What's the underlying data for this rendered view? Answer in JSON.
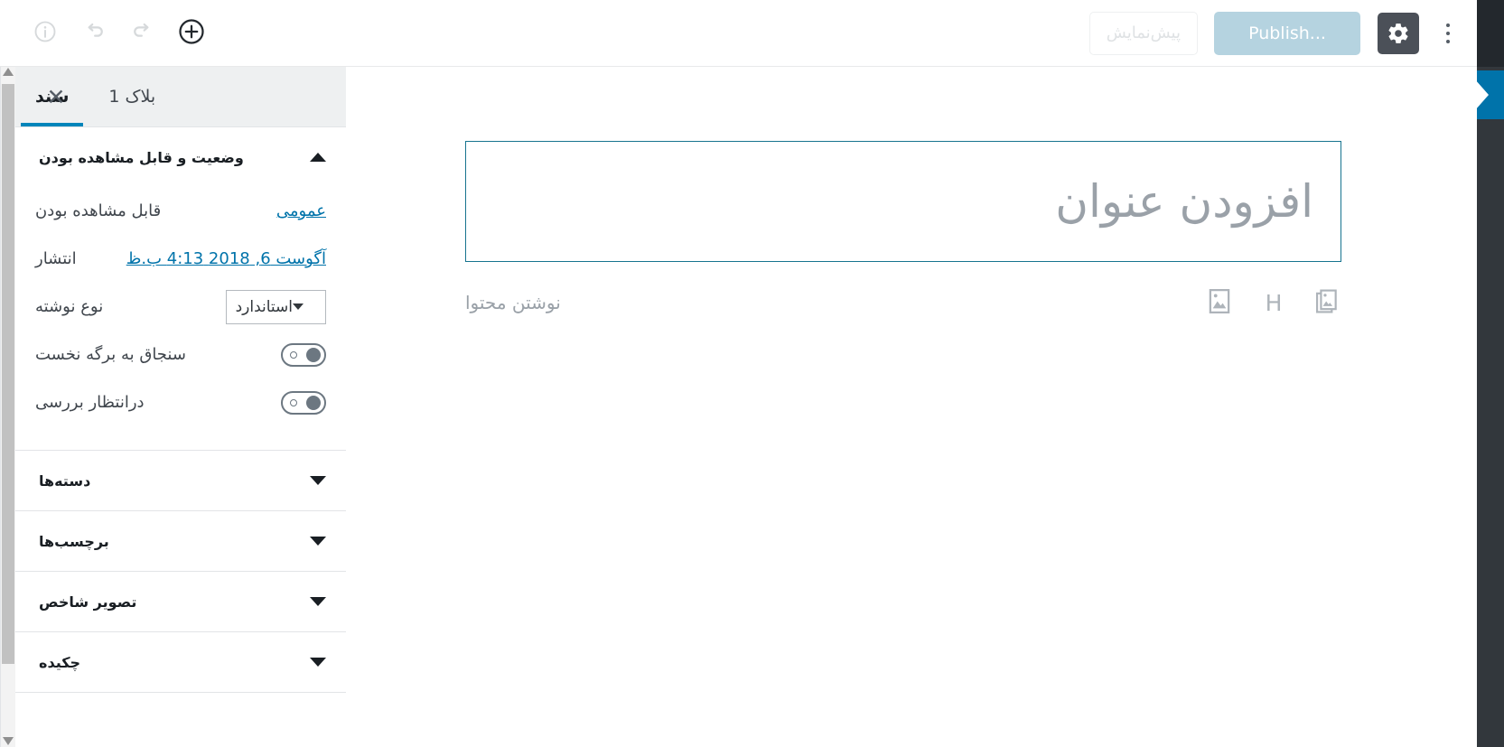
{
  "topbar": {
    "ellipsis_label": "گزینه‌های بیشتر",
    "gear_icon": "gear-icon",
    "publish_label": "Publish...",
    "preview_label": "پیش‌نمایش",
    "info_icon": "info-icon",
    "redo_icon": "redo-icon",
    "undo_icon": "undo-icon",
    "add_block_icon": "plus-circle-icon"
  },
  "sidebar": {
    "tabs": [
      {
        "label": "سند",
        "active": true
      },
      {
        "label": "بلاک 1",
        "active": false
      }
    ],
    "close_label": "✕",
    "panels": [
      {
        "title": "وضعیت و قابل مشاهده بودن",
        "expanded": true,
        "rows": [
          {
            "label": "قابل مشاهده بودن",
            "value": "عمومی",
            "type": "link"
          },
          {
            "label": "انتشار",
            "value": "آگوست 6, 2018 4:13 ب.ظ",
            "type": "link"
          },
          {
            "label": "نوع نوشته",
            "value": "استاندارد",
            "type": "select"
          },
          {
            "label": "سنجاق به برگه نخست",
            "value": "off",
            "type": "toggle"
          },
          {
            "label": "درانتظار بررسی",
            "value": "off",
            "type": "toggle"
          }
        ]
      },
      {
        "title": "دسته‌ها",
        "expanded": false,
        "rows": []
      },
      {
        "title": "برچسب‌ها",
        "expanded": false,
        "rows": []
      },
      {
        "title": "تصویر شاخص",
        "expanded": false,
        "rows": []
      },
      {
        "title": "چکیده",
        "expanded": false,
        "rows": []
      }
    ]
  },
  "editor": {
    "title_placeholder": "افزودن عنوان",
    "content_placeholder": "نوشتن محتوا",
    "inserters": [
      {
        "name": "gallery-icon"
      },
      {
        "name": "heading-icon",
        "glyph": "H"
      },
      {
        "name": "image-icon"
      }
    ]
  },
  "colors": {
    "accent": "#0085ba",
    "rail_blue": "#0073aa",
    "rail_dark": "#32373c",
    "publish_disabled": "#b5d3e0",
    "title_border": "#17748f",
    "placeholder_text": "#9aa1a8"
  }
}
